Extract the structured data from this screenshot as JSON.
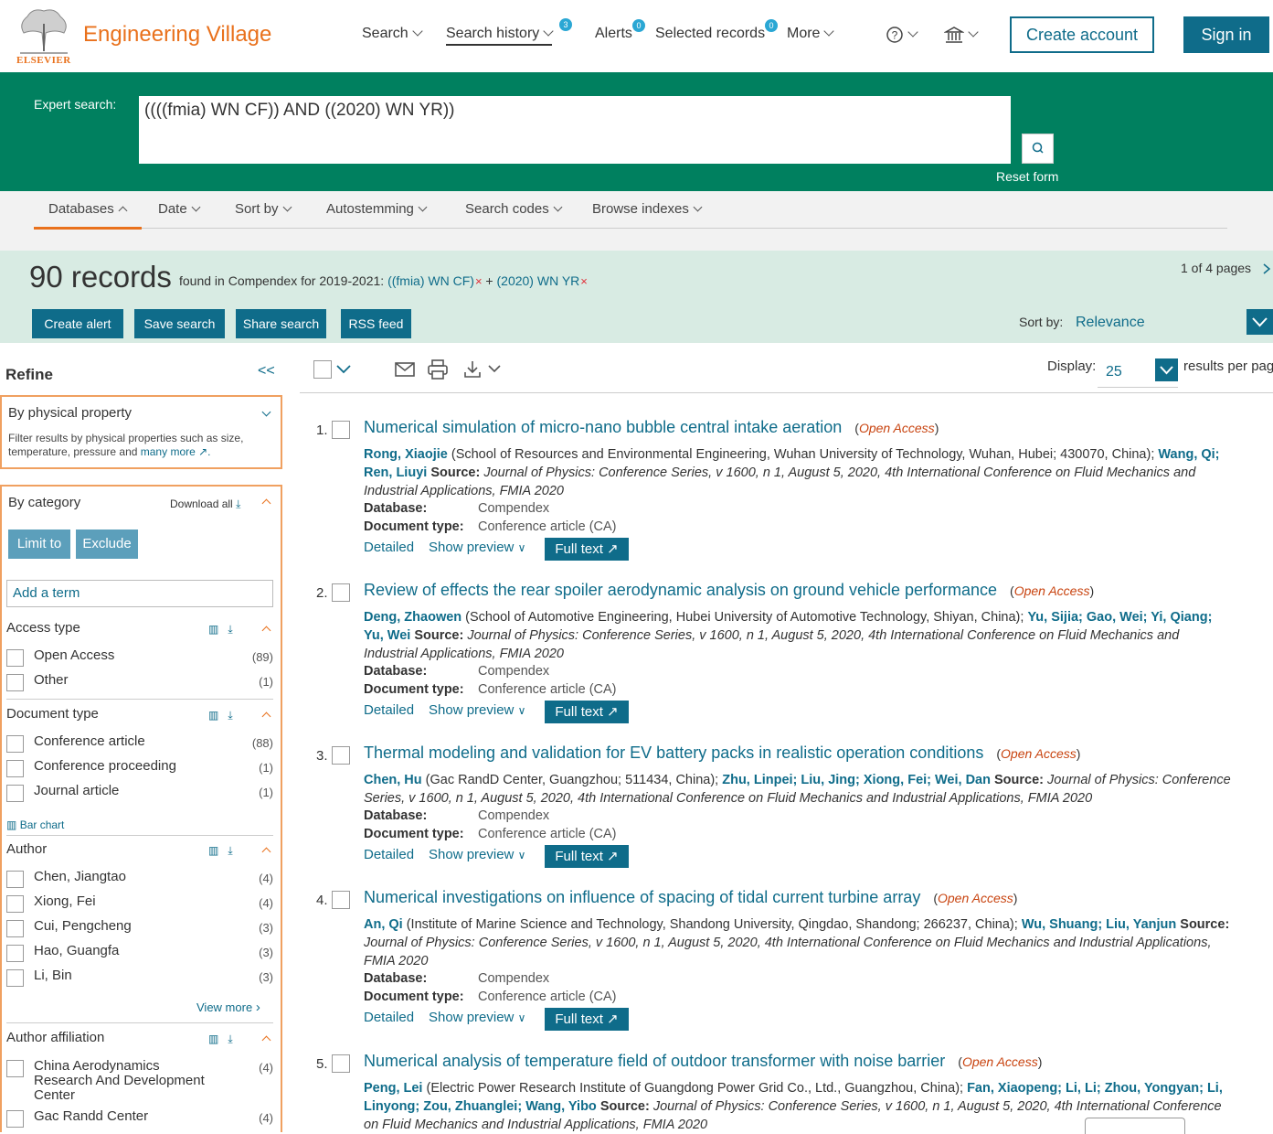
{
  "header": {
    "brand": "Engineering Village",
    "publisher": "ELSEVIER",
    "nav": {
      "search": "Search",
      "history": "Search history",
      "history_badge": "3",
      "alerts": "Alerts",
      "alerts_badge": "0",
      "selected": "Selected records",
      "selected_badge": "0",
      "more": "More"
    },
    "create_account": "Create account",
    "sign_in": "Sign in"
  },
  "search": {
    "label": "Expert search:",
    "query": "((((fmia) WN CF)) AND ((2020) WN YR))",
    "reset": "Reset form"
  },
  "options": {
    "databases": "Databases",
    "date": "Date",
    "sort_by": "Sort by",
    "autostemming": "Autostemming",
    "search_codes": "Search codes",
    "browse_indexes": "Browse indexes"
  },
  "results_header": {
    "count": "90 records",
    "found": "found in Compendex for 2019-2021:",
    "term1": "((fmia) WN CF)",
    "plus": "+",
    "term2": "(2020) WN YR",
    "remove": "×",
    "pages": "1 of 4 pages",
    "create_alert": "Create alert",
    "save_search": "Save search",
    "share_search": "Share search",
    "rss_feed": "RSS feed",
    "sort_label": "Sort by:",
    "sort_value": "Relevance"
  },
  "refine": {
    "title": "Refine",
    "collapse": "<<",
    "physical": {
      "title": "By physical property",
      "desc": "Filter results by physical properties such as size, temperature, pressure and",
      "more_link": "many more"
    },
    "category": {
      "title": "By category",
      "download_all": "Download all",
      "limit_to": "Limit to",
      "exclude": "Exclude",
      "add_term": "Add a term"
    },
    "access_type": {
      "title": "Access type",
      "items": [
        {
          "label": "Open Access",
          "count": "(89)"
        },
        {
          "label": "Other",
          "count": "(1)"
        }
      ]
    },
    "document_type": {
      "title": "Document type",
      "items": [
        {
          "label": "Conference article",
          "count": "(88)"
        },
        {
          "label": "Conference proceeding",
          "count": "(1)"
        },
        {
          "label": "Journal article",
          "count": "(1)"
        }
      ],
      "bar_chart": "Bar chart"
    },
    "author": {
      "title": "Author",
      "items": [
        {
          "label": "Chen, Jiangtao",
          "count": "(4)"
        },
        {
          "label": "Xiong, Fei",
          "count": "(4)"
        },
        {
          "label": "Cui, Pengcheng",
          "count": "(3)"
        },
        {
          "label": "Hao, Guangfa",
          "count": "(3)"
        },
        {
          "label": "Li, Bin",
          "count": "(3)"
        }
      ],
      "view_more": "View more"
    },
    "affiliation": {
      "title": "Author affiliation",
      "items": [
        {
          "label": "China Aerodynamics Research And Development Center",
          "count": "(4)"
        },
        {
          "label": "Gac Randd Center",
          "count": "(4)"
        }
      ]
    }
  },
  "toolbar": {
    "display_label": "Display:",
    "display_value": "25",
    "per_page": "results per page"
  },
  "labels": {
    "source": "Source:",
    "database": "Database:",
    "doc_type": "Document type:",
    "detailed": "Detailed",
    "show_preview": "Show preview",
    "full_text": "Full text",
    "open_access": "Open Access"
  },
  "results": [
    {
      "num": "1.",
      "title": "Numerical simulation of micro-nano bubble central intake aeration",
      "a1": "Rong, Xiaojie",
      "aff": " (School of Resources and Environmental Engineering, Wuhan University of Technology, Wuhan, Hubei; 430070, China); ",
      "others": "Wang, Qi; Ren, Liuyi",
      "source": "Journal of Physics: Conference Series, v 1600, n 1, August 5, 2020, 4th International Conference on Fluid Mechanics and Industrial Applications, FMIA 2020",
      "database": "Compendex",
      "doc_type": "Conference article (CA)"
    },
    {
      "num": "2.",
      "title": "Review of effects the rear spoiler aerodynamic analysis on ground vehicle performance",
      "a1": "Deng, Zhaowen",
      "aff": " (School of Automotive Engineering, Hubei University of Automotive Technology, Shiyan, China); ",
      "others": "Yu, Sijia; Gao, Wei; Yi, Qiang; Yu, Wei",
      "source": "Journal of Physics: Conference Series, v 1600, n 1, August 5, 2020, 4th International Conference on Fluid Mechanics and Industrial Applications, FMIA 2020",
      "database": "Compendex",
      "doc_type": "Conference article (CA)"
    },
    {
      "num": "3.",
      "title": "Thermal modeling and validation for EV battery packs in realistic operation conditions",
      "a1": "Chen, Hu",
      "aff": " (Gac RandD Center, Guangzhou; 511434, China); ",
      "others": "Zhu, Linpei; Liu, Jing; Xiong, Fei; Wei, Dan",
      "source": "Journal of Physics: Conference Series, v 1600, n 1, August 5, 2020, 4th International Conference on Fluid Mechanics and Industrial Applications, FMIA 2020",
      "database": "Compendex",
      "doc_type": "Conference article (CA)"
    },
    {
      "num": "4.",
      "title": "Numerical investigations on influence of spacing of tidal current turbine array",
      "a1": "An, Qi",
      "aff": " (Institute of Marine Science and Technology, Shandong University, Qingdao, Shandong; 266237, China); ",
      "others": "Wu, Shuang; Liu, Yanjun",
      "source": "Journal of Physics: Conference Series, v 1600, n 1, August 5, 2020, 4th International Conference on Fluid Mechanics and Industrial Applications, FMIA 2020",
      "database": "Compendex",
      "doc_type": "Conference article (CA)"
    },
    {
      "num": "5.",
      "title": "Numerical analysis of temperature field of outdoor transformer with noise barrier",
      "a1": "Peng, Lei",
      "aff": " (Electric Power Research Institute of Guangdong Power Grid Co., Ltd., Guangzhou, China); ",
      "others": "Fan, Xiaopeng; Li, Li; Zhou, Yongyan; Li, Linyong; Zou, Zhuanglei; Wang, Yibo",
      "source": "Journal of Physics: Conference Series, v 1600, n 1, August 5, 2020, 4th International Conference on Fluid Mechanics and Industrial Applications, FMIA 2020",
      "database": "",
      "doc_type": ""
    }
  ],
  "colors": {
    "brand_orange": "#e9711c",
    "teal": "#0f6c8a",
    "search_green": "#00805f",
    "results_band": "#d8ebe3"
  }
}
